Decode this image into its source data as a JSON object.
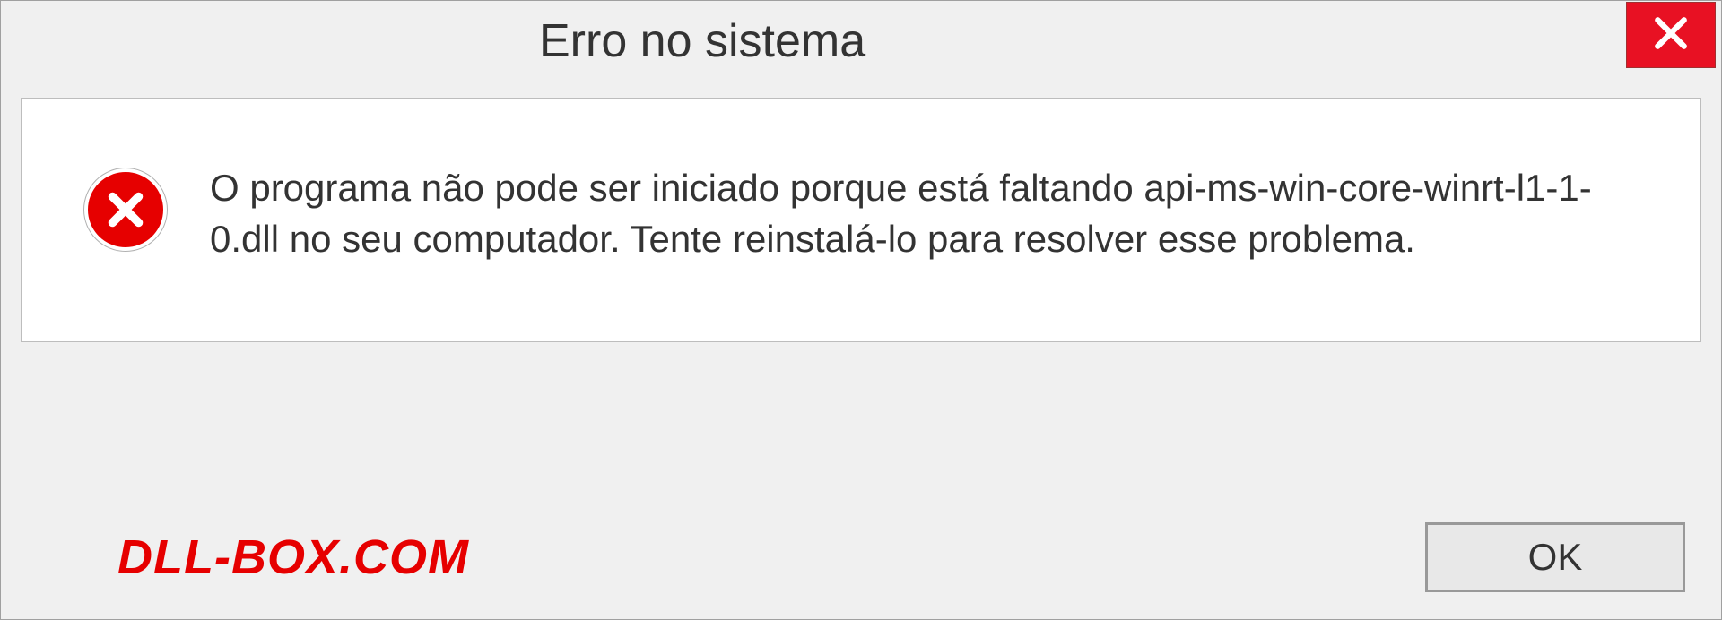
{
  "dialog": {
    "title": "Erro no sistema",
    "message": "O programa não pode ser iniciado porque está faltando api-ms-win-core-winrt-l1-1-0.dll no seu computador. Tente reinstalá-lo para resolver esse problema.",
    "ok_label": "OK"
  },
  "branding": {
    "text": "DLL-BOX.COM"
  },
  "icons": {
    "close": "close-icon",
    "error": "error-icon"
  },
  "colors": {
    "close_bg": "#e81123",
    "error_bg": "#e60000",
    "brand": "#e60000"
  }
}
